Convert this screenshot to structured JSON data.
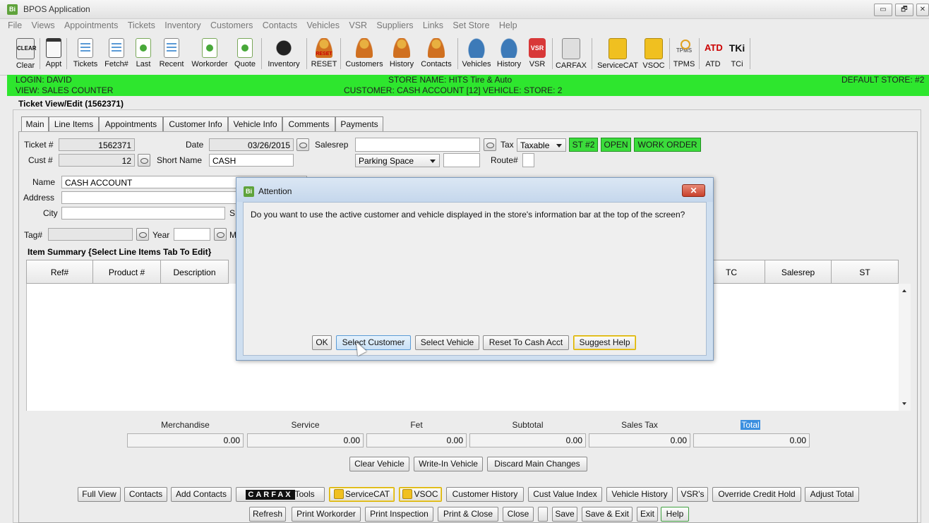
{
  "window": {
    "title": "BPOS Application",
    "app_icon": "Bi",
    "minimize": "▭",
    "restore": "🗗",
    "close": "✕"
  },
  "menu": [
    "File",
    "Views",
    "Appointments",
    "Tickets",
    "Inventory",
    "Customers",
    "Contacts",
    "Vehicles",
    "VSR",
    "Suppliers",
    "Links",
    "Set Store",
    "Help"
  ],
  "toolbar": {
    "clear": "Clear",
    "clear_icon_text": "CLEAR",
    "appt": "Appt",
    "tickets": "Tickets",
    "fetch": "Fetch#",
    "last": "Last",
    "recent": "Recent",
    "workorder": "Workorder",
    "quote": "Quote",
    "inventory": "Inventory",
    "reset": "RESET",
    "reset_icon_text": "RESET",
    "customers": "Customers",
    "history1": "History",
    "contacts": "Contacts",
    "vehicles": "Vehicles",
    "history2": "History",
    "vsr": "VSR",
    "vsr_icon_text": "VSR",
    "carfax": "CARFAX",
    "servicecat": "ServiceCAT",
    "vsoc": "VSOC",
    "tpms": "TPMS",
    "tpms_icon_text": "TPMS",
    "atd": "ATD",
    "atd_icon_text": "ATD",
    "tci": "TCi",
    "tci_icon_text": "TKi"
  },
  "infobar": {
    "login": "LOGIN: DAVID",
    "view": "VIEW: SALES COUNTER",
    "store_name": "STORE NAME: HITS Tire & Auto",
    "customer_line": "CUSTOMER: CASH ACCOUNT [12]   VEHICLE:    STORE: 2",
    "default_store": "DEFAULT STORE: #2",
    "color": "#2ee62e"
  },
  "panel": {
    "title": "Ticket View/Edit (1562371)"
  },
  "tabs": [
    "Main",
    "Line Items",
    "Appointments",
    "Customer Info",
    "Vehicle Info",
    "Comments",
    "Payments"
  ],
  "form": {
    "ticket_label": "Ticket #",
    "ticket_value": "1562371",
    "cust_label": "Cust #",
    "cust_value": "12",
    "date_label": "Date",
    "date_value": "03/26/2015",
    "shortname_label": "Short Name",
    "shortname_value": "CASH",
    "salesrep_label": "Salesrep",
    "salesrep_value": "",
    "tax_label": "Tax",
    "tax_value": "Taxable",
    "parking_value": "Parking Space",
    "parking_extra": "",
    "route_label": "Route#",
    "badges": [
      "ST #2",
      "OPEN",
      "WORK ORDER"
    ],
    "name_label": "Name",
    "name_value": "CASH ACCOUNT",
    "address_label": "Address",
    "address_value": "",
    "city_label": "City",
    "city_value": "",
    "state_label_partial": "S",
    "tag_label": "Tag#",
    "tag_value": "",
    "year_label": "Year",
    "year_value": "",
    "make_label_partial": "M"
  },
  "item_summary": {
    "title": "Item Summary {Select Line Items Tab To Edit}",
    "columns_left": [
      "Ref#",
      "Product #",
      "Description"
    ],
    "columns_right": [
      "TC",
      "Salesrep",
      "ST"
    ]
  },
  "totals": {
    "merchandise": {
      "label": "Merchandise",
      "value": "0.00"
    },
    "service": {
      "label": "Service",
      "value": "0.00"
    },
    "fet": {
      "label": "Fet",
      "value": "0.00"
    },
    "subtotal": {
      "label": "Subtotal",
      "value": "0.00"
    },
    "sales_tax": {
      "label": "Sales Tax",
      "value": "0.00"
    },
    "total": {
      "label": "Total",
      "value": "0.00"
    }
  },
  "vehicle_buttons": {
    "clear_vehicle": "Clear Vehicle",
    "write_in": "Write-In Vehicle",
    "discard": "Discard Main Changes"
  },
  "bottom_row1": {
    "full_view": "Full View",
    "contacts": "Contacts",
    "add_contacts": "Add Contacts",
    "carfax_logo": "CARFAX",
    "carfax_tools": "Tools",
    "servicecat": "ServiceCAT",
    "vsoc": "VSOC",
    "customer_history": "Customer History",
    "cust_value_index": "Cust Value Index",
    "vehicle_history": "Vehicle History",
    "vsrs": "VSR's",
    "override_credit": "Override Credit Hold",
    "adjust_total": "Adjust Total"
  },
  "bottom_row2": {
    "refresh": "Refresh",
    "print_workorder": "Print Workorder",
    "print_inspection": "Print Inspection",
    "print_close": "Print & Close",
    "close": "Close",
    "blank": "",
    "save": "Save",
    "save_exit": "Save & Exit",
    "exit": "Exit",
    "help": "Help"
  },
  "dialog": {
    "title": "Attention",
    "icon_text": "Bi",
    "close": "✕",
    "message": "Do you want to use the active customer and vehicle displayed in the store's information bar at the top of the screen?",
    "buttons": {
      "ok": "OK",
      "select_customer": "Select Customer",
      "select_vehicle": "Select Vehicle",
      "reset_cash": "Reset To Cash Acct",
      "suggest_help": "Suggest Help"
    }
  }
}
